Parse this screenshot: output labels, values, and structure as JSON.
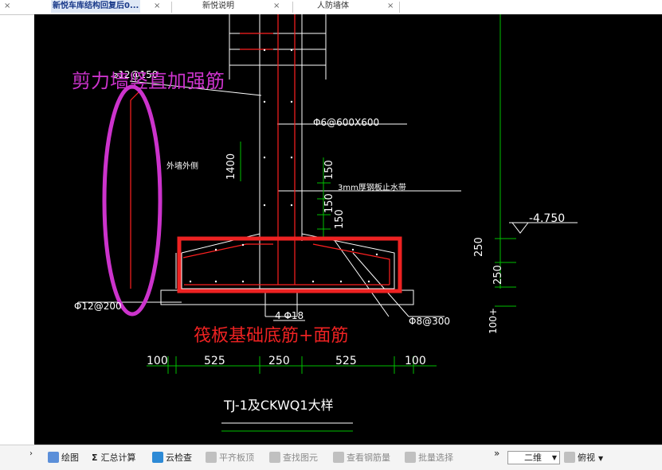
{
  "tabs": [
    {
      "label": "新悦车库结构回复后0..."
    },
    {
      "label": "新悦说明"
    },
    {
      "label": "人防墙体"
    }
  ],
  "close_glyph": "×",
  "drawing": {
    "annotations": {
      "shear_wall": "剪力墙竖直加强筋",
      "raft": "筏板基础底筋+面筋"
    },
    "labels": {
      "top_bar": "⌀12@150",
      "tie": "Φ6@600X600",
      "outer_wall": "外墙外侧",
      "dim_1400": "1400",
      "dim_150a": "150",
      "dim_150b": "150",
      "dim_150c": "150",
      "waterstop": "3mm厚钢板止水带",
      "level": "-4.750",
      "dim_250a": "250",
      "dim_250b": "250",
      "dim_100": "100+",
      "left_bar": "Φ12@200",
      "bottom_bars": "4 Φ18",
      "right_bar": "Φ8@300",
      "title": "TJ-1及CKWQ1大样"
    },
    "dims": [
      "100",
      "525",
      "250",
      "525",
      "100"
    ]
  },
  "colors": {
    "canvas": "#000000",
    "red": "#ff2020",
    "green": "#00c000",
    "white": "#ffffff",
    "magenta": "#cc33cc",
    "box": "#ee2222"
  },
  "toolbar": {
    "items": [
      {
        "label": "绘图",
        "icon": "draw-icon"
      },
      {
        "label": "汇总计算",
        "icon": "sigma-icon"
      },
      {
        "label": "云检查",
        "icon": "cloud-check-icon"
      },
      {
        "label": "平齐板顶",
        "icon": "align-top-icon"
      },
      {
        "label": "查找图元",
        "icon": "binoculars-icon"
      },
      {
        "label": "查看钢筋量",
        "icon": "rebar-view-icon"
      },
      {
        "label": "批量选择",
        "icon": "batch-select-icon"
      }
    ],
    "more": "»",
    "view_mode": "二维",
    "view_angle": "俯视"
  }
}
